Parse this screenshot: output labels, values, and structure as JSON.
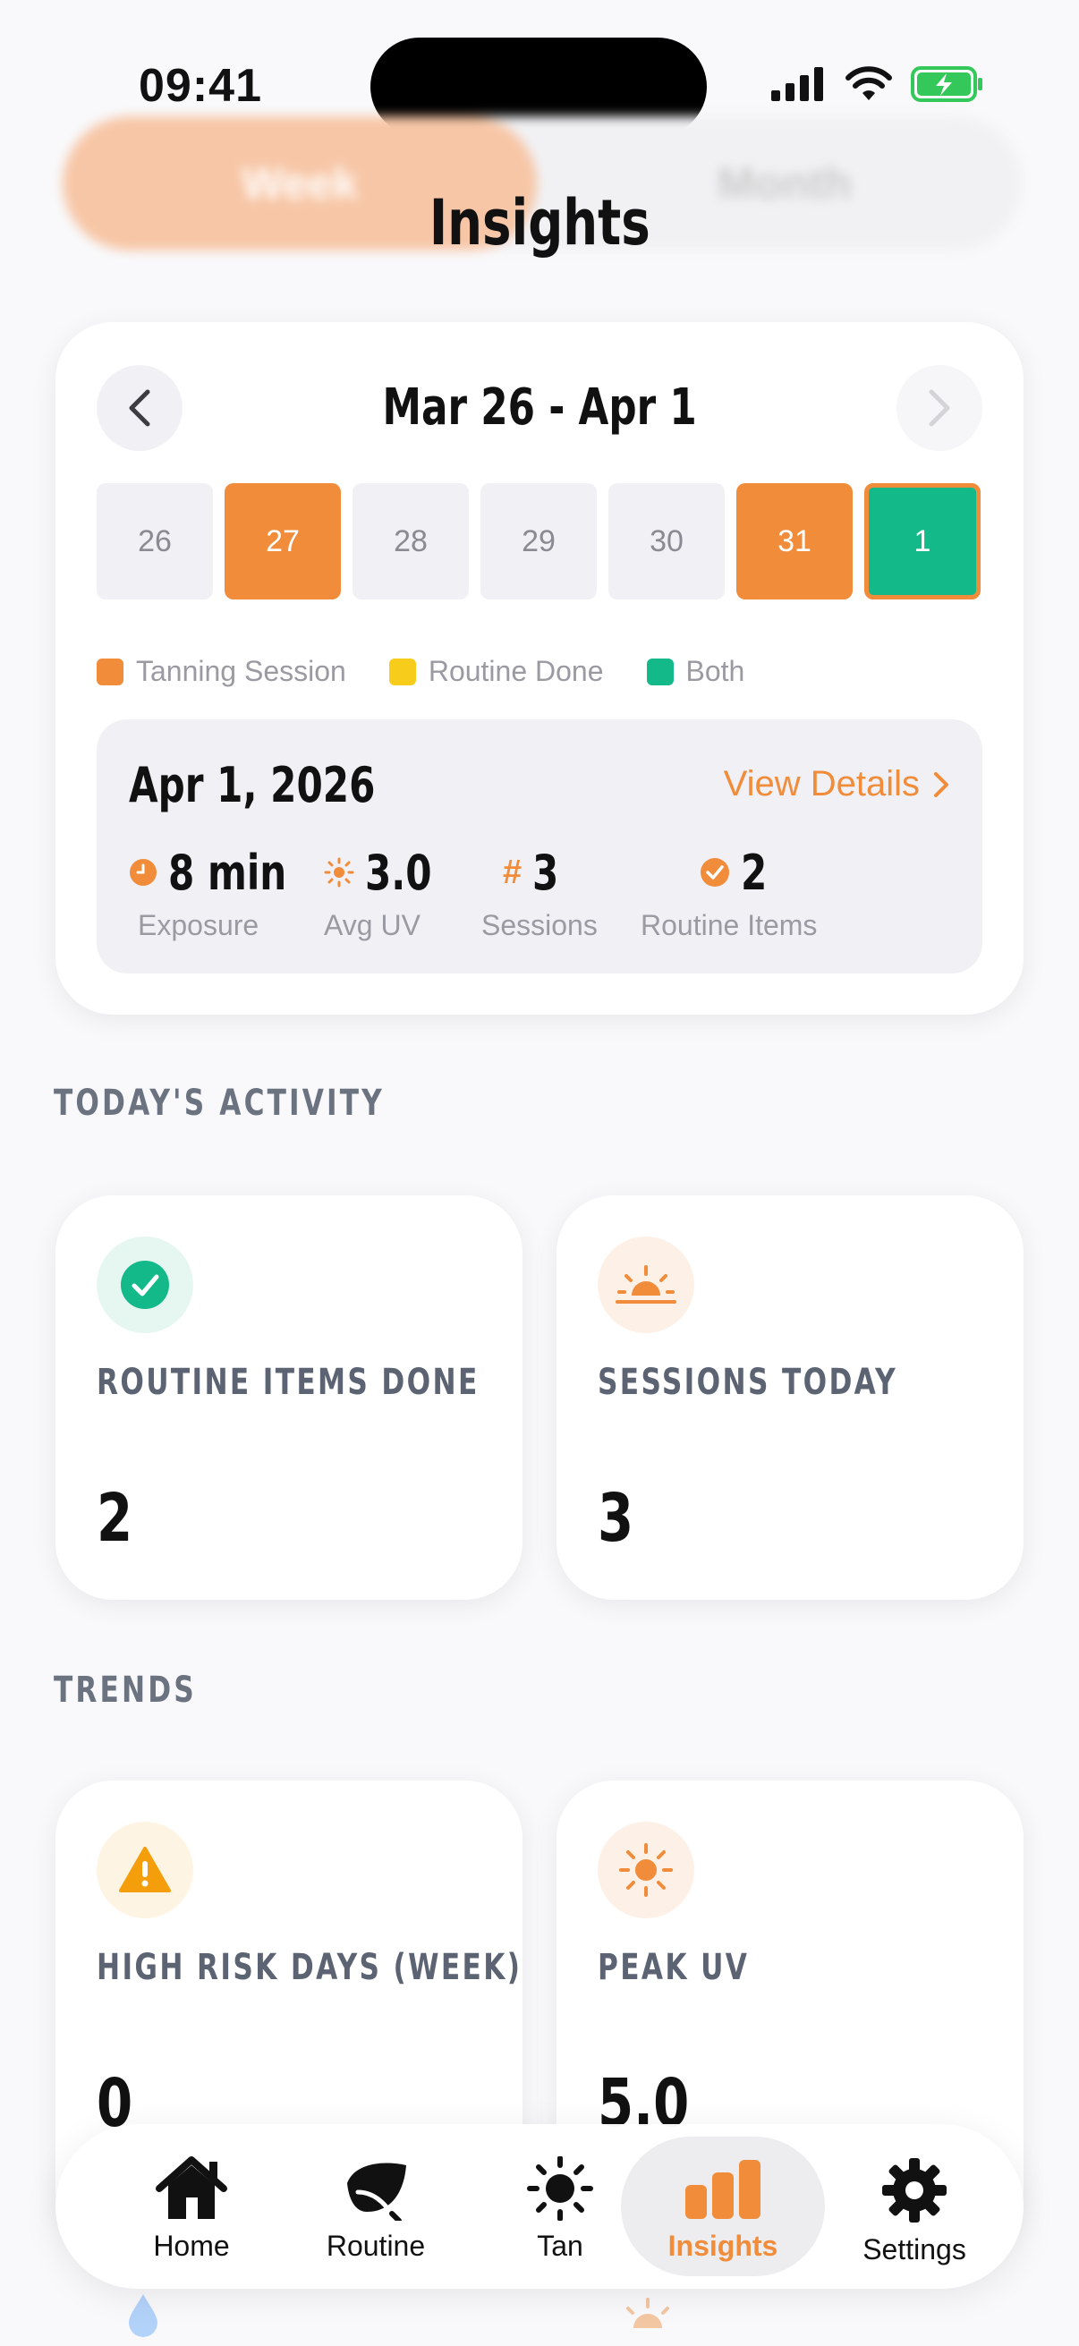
{
  "status_bar": {
    "time": "09:41"
  },
  "segmented": {
    "week": "Week",
    "month": "Month"
  },
  "page_title": "Insights",
  "calendar": {
    "range": "Mar 26 - Apr 1",
    "days": [
      "26",
      "27",
      "28",
      "29",
      "30",
      "31",
      "1"
    ],
    "legend": {
      "tanning": "Tanning Session",
      "routine": "Routine Done",
      "both": "Both"
    },
    "colors": {
      "tanning": "#F08C3A",
      "routine": "#F7CC1A",
      "both": "#14B98A"
    }
  },
  "detail": {
    "date": "Apr 1, 2026",
    "link": "View Details",
    "stats": [
      {
        "value": "8 min",
        "label": "Exposure"
      },
      {
        "value": "3.0",
        "label": "Avg UV"
      },
      {
        "value": "3",
        "label": "Sessions"
      },
      {
        "value": "2",
        "label": "Routine Items"
      }
    ]
  },
  "today": {
    "heading": "TODAY'S ACTIVITY",
    "routine": {
      "label": "ROUTINE ITEMS DONE",
      "value": "2"
    },
    "sessions": {
      "label": "SESSIONS TODAY",
      "value": "3"
    }
  },
  "trends": {
    "heading": "TRENDS",
    "risk": {
      "label": "HIGH RISK DAYS (WEEK)",
      "value": "0"
    },
    "peak": {
      "label": "PEAK UV",
      "value": "5.0"
    }
  },
  "tabs": [
    {
      "label": "Home",
      "icon": "house-icon"
    },
    {
      "label": "Routine",
      "icon": "leaf-icon"
    },
    {
      "label": "Tan",
      "icon": "sun-icon"
    },
    {
      "label": "Insights",
      "icon": "bar-chart-icon"
    },
    {
      "label": "Settings",
      "icon": "gear-icon"
    }
  ]
}
